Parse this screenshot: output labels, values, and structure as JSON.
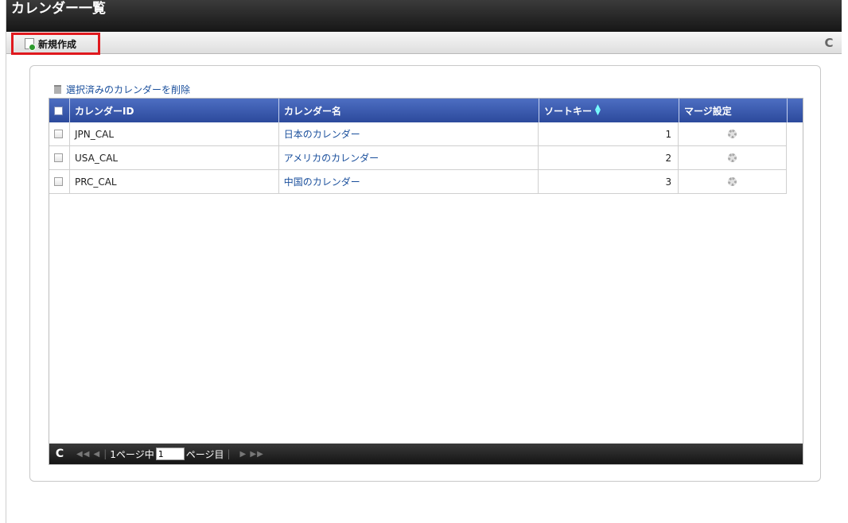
{
  "window": {
    "title": "カレンダー一覧"
  },
  "toolbar": {
    "new_label": "新規作成"
  },
  "panel": {
    "delete_label": "選択済みのカレンダーを削除"
  },
  "grid": {
    "columns": [
      "カレンダーID",
      "カレンダー名",
      "ソートキー",
      "マージ設定"
    ],
    "rows": [
      {
        "id": "JPN_CAL",
        "name": "日本のカレンダー",
        "sort": "1"
      },
      {
        "id": "USA_CAL",
        "name": "アメリカのカレンダー",
        "sort": "2"
      },
      {
        "id": "PRC_CAL",
        "name": "中国のカレンダー",
        "sort": "3"
      }
    ]
  },
  "pager": {
    "page_of": "1ページ中",
    "current_page": "1",
    "page_suffix": "ページ目"
  },
  "colors": {
    "accent": "#2c4a9c",
    "link": "#1a4f9c",
    "highlight_border": "#e0191e"
  }
}
